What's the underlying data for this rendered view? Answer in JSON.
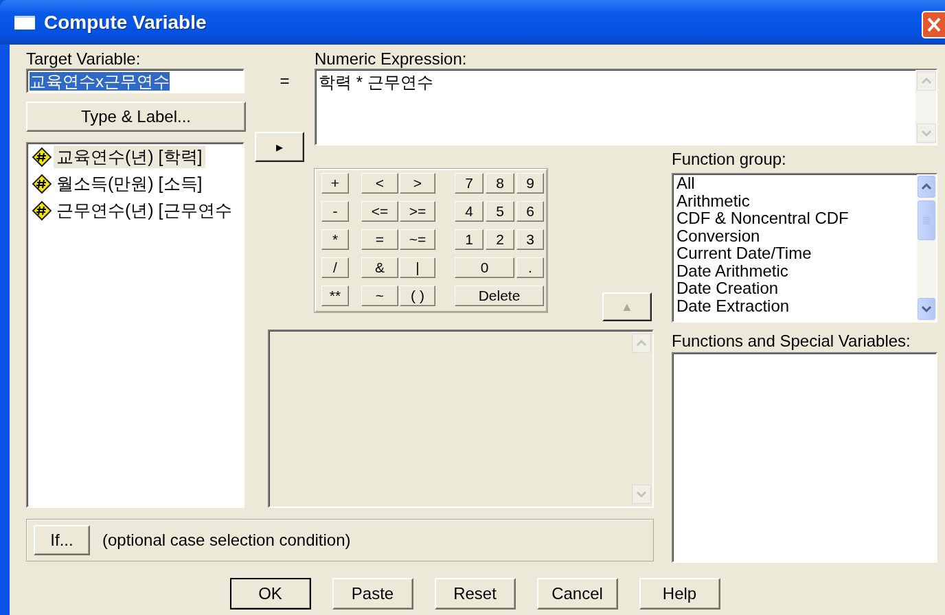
{
  "window": {
    "title": "Compute Variable"
  },
  "target": {
    "label": "Target Variable:",
    "value": "교육연수x근무연수",
    "selected": true
  },
  "equals": "=",
  "expression": {
    "label": "Numeric Expression:",
    "value": "학력 * 근무연수"
  },
  "type_label_button": "Type & Label...",
  "arrow_button": "▸",
  "variables": [
    {
      "label": "교육연수(년) [학력]",
      "selected": true
    },
    {
      "label": "월소득(만원) [소득]",
      "selected": false
    },
    {
      "label": "근무연수(년) [근무연수",
      "selected": false
    }
  ],
  "keypad": {
    "arithmetic": [
      "+",
      "-",
      "*",
      "/",
      "**"
    ],
    "relational": [
      [
        "<",
        ">"
      ],
      [
        "<=",
        ">="
      ],
      [
        "=",
        "~="
      ],
      [
        "&",
        "|"
      ],
      [
        "~",
        "( )"
      ]
    ],
    "numeric": [
      [
        {
          "label": "7",
          "kind": "single"
        },
        {
          "label": "8",
          "kind": "single"
        },
        {
          "label": "9",
          "kind": "single"
        }
      ],
      [
        {
          "label": "4",
          "kind": "single"
        },
        {
          "label": "5",
          "kind": "single"
        },
        {
          "label": "6",
          "kind": "single"
        }
      ],
      [
        {
          "label": "1",
          "kind": "single"
        },
        {
          "label": "2",
          "kind": "single"
        },
        {
          "label": "3",
          "kind": "single"
        }
      ],
      [
        {
          "label": "0",
          "kind": "double"
        },
        {
          "label": ".",
          "kind": "single"
        }
      ],
      [
        {
          "label": "Delete",
          "kind": "triple"
        }
      ]
    ]
  },
  "up_button": "▲",
  "function_group": {
    "label": "Function group:",
    "items": [
      {
        "label": "All",
        "selected": false
      },
      {
        "label": "Arithmetic",
        "selected": false
      },
      {
        "label": "CDF & Noncentral CDF",
        "selected": false
      },
      {
        "label": "Conversion",
        "selected": false
      },
      {
        "label": "Current Date/Time",
        "selected": false
      },
      {
        "label": "Date Arithmetic",
        "selected": false
      },
      {
        "label": "Date Creation",
        "selected": false
      },
      {
        "label": "Date Extraction",
        "selected": false
      }
    ]
  },
  "functions": {
    "label": "Functions and Special Variables:"
  },
  "if_button": "If...",
  "if_condition": "(optional case selection condition)",
  "buttons": [
    {
      "label": "OK",
      "default": true
    },
    {
      "label": "Paste",
      "default": false
    },
    {
      "label": "Reset",
      "default": false
    },
    {
      "label": "Cancel",
      "default": false
    },
    {
      "label": "Help",
      "default": false
    }
  ]
}
